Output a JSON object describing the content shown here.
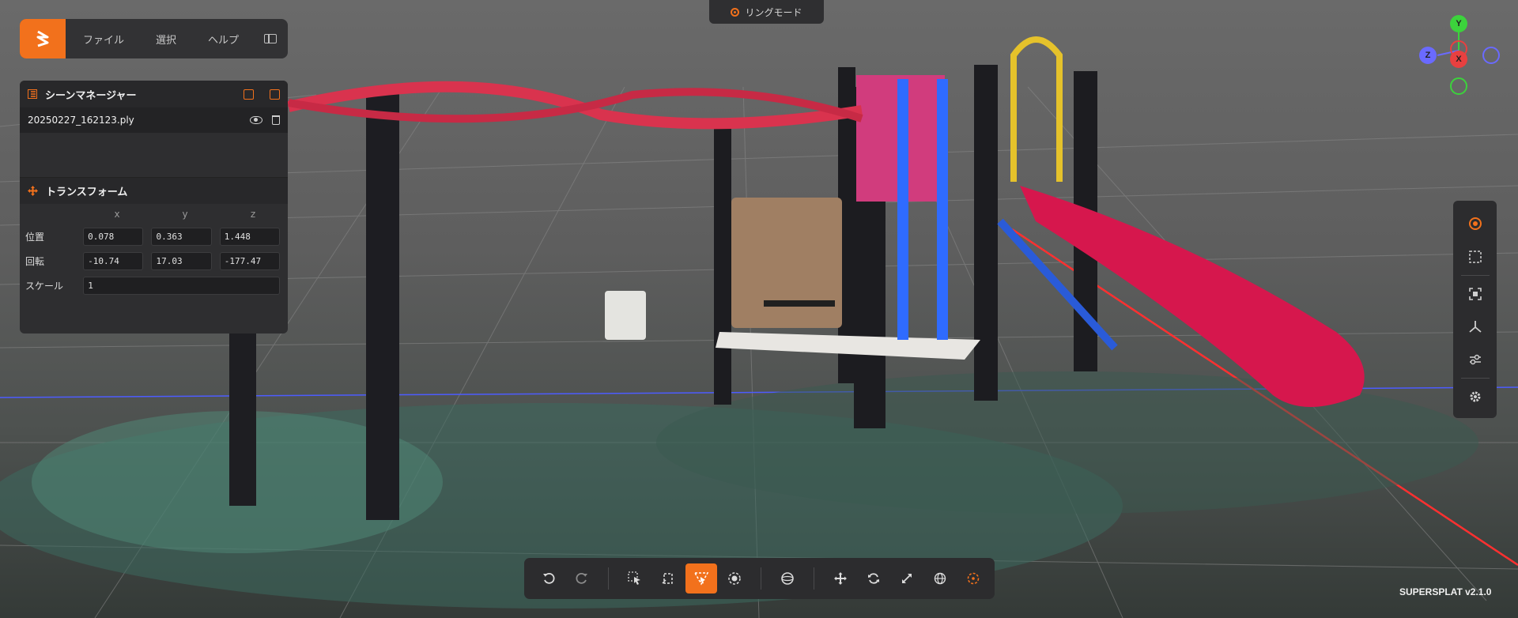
{
  "app": {
    "name": "SuperSplat",
    "version_label": "SUPERSPLAT v2.1.0",
    "accent_color": "#f2711c"
  },
  "menu": {
    "items": [
      "ファイル",
      "選択",
      "ヘルプ"
    ],
    "logo_icon": "supersplat-logo-icon",
    "collapse_icon": "panel-collapse-icon"
  },
  "mode_badge": {
    "label": "リングモード",
    "icon": "ring-mode-icon"
  },
  "scene_manager": {
    "title": "シーンマネージャー",
    "title_icon": "list-icon",
    "header_icons": [
      "import-icon",
      "export-icon"
    ],
    "files": [
      {
        "name": "20250227_162123.ply",
        "icons": [
          "eye-icon",
          "trash-icon"
        ]
      }
    ]
  },
  "transform": {
    "title": "トランスフォーム",
    "title_icon": "move-icon",
    "axes": [
      "x",
      "y",
      "z"
    ],
    "position": {
      "label": "位置",
      "values": [
        "0.078",
        "0.363",
        "1.448"
      ]
    },
    "rotation": {
      "label": "回転",
      "values": [
        "-10.74",
        "17.03",
        "-177.47"
      ]
    },
    "scale": {
      "label": "スケール",
      "value": "1"
    }
  },
  "gizmo": {
    "labels": {
      "y": "Y",
      "z": "Z",
      "x": "X"
    },
    "colors": {
      "x": "#e84040",
      "y": "#3cd23c",
      "z": "#6a6aff"
    }
  },
  "right_toolbar": {
    "buttons": [
      "splat-centers-icon",
      "bounding-box-icon",
      "frame-selection-icon",
      "axes-icon",
      "color-adjust-icon",
      "settings-icon"
    ]
  },
  "bottom_toolbar": {
    "buttons": [
      "undo-icon",
      "redo-icon",
      "picker-select-icon",
      "lasso-select-icon",
      "polygon-select-icon",
      "brush-select-icon",
      "sphere-select-icon",
      "translate-icon",
      "rotate-icon",
      "scale-icon",
      "world-space-icon",
      "pivot-icon"
    ],
    "active": "polygon-select-icon"
  }
}
